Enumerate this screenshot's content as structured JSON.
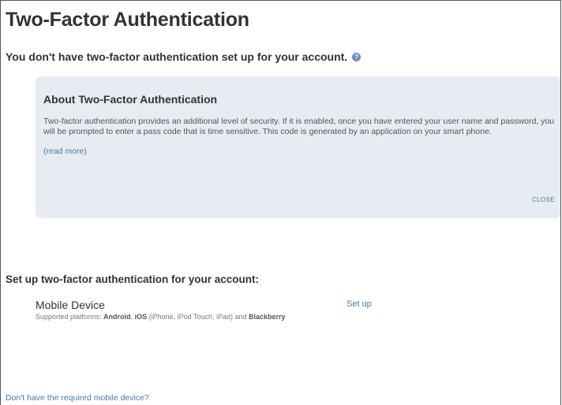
{
  "page": {
    "title": "Two-Factor Authentication",
    "status_message": "You don't have two-factor authentication set up for your account.",
    "help_icon": "question-circle-icon"
  },
  "about_box": {
    "title": "About Two-Factor Authentication",
    "description": "Two-factor authentication provides an additional level of security. If it is enabled, once you have entered your user name and password, you will be prompted to enter a pass code that is time sensitive. This code is generated by an application on your smart phone.",
    "read_more_label": "(read more)",
    "close_label": "CLOSE",
    "background_color": "#e6ecf1"
  },
  "setup": {
    "heading": "Set up two-factor authentication for your account:",
    "device": {
      "name": "Mobile Device",
      "platforms_prefix": "Supported platforms: ",
      "platform_android": "Android",
      "platform_separator": ", ",
      "platform_ios": "iOS",
      "platform_ios_detail": " (iPhone, iPod Touch, iPad) and ",
      "platform_blackberry": "Blackberry",
      "setup_label": "Set up"
    }
  },
  "footer": {
    "no_device_link": "Don't have the required mobile device?"
  },
  "colors": {
    "link": "#4a7ba8",
    "text": "#333333",
    "help_icon": "#6d8fb8"
  }
}
